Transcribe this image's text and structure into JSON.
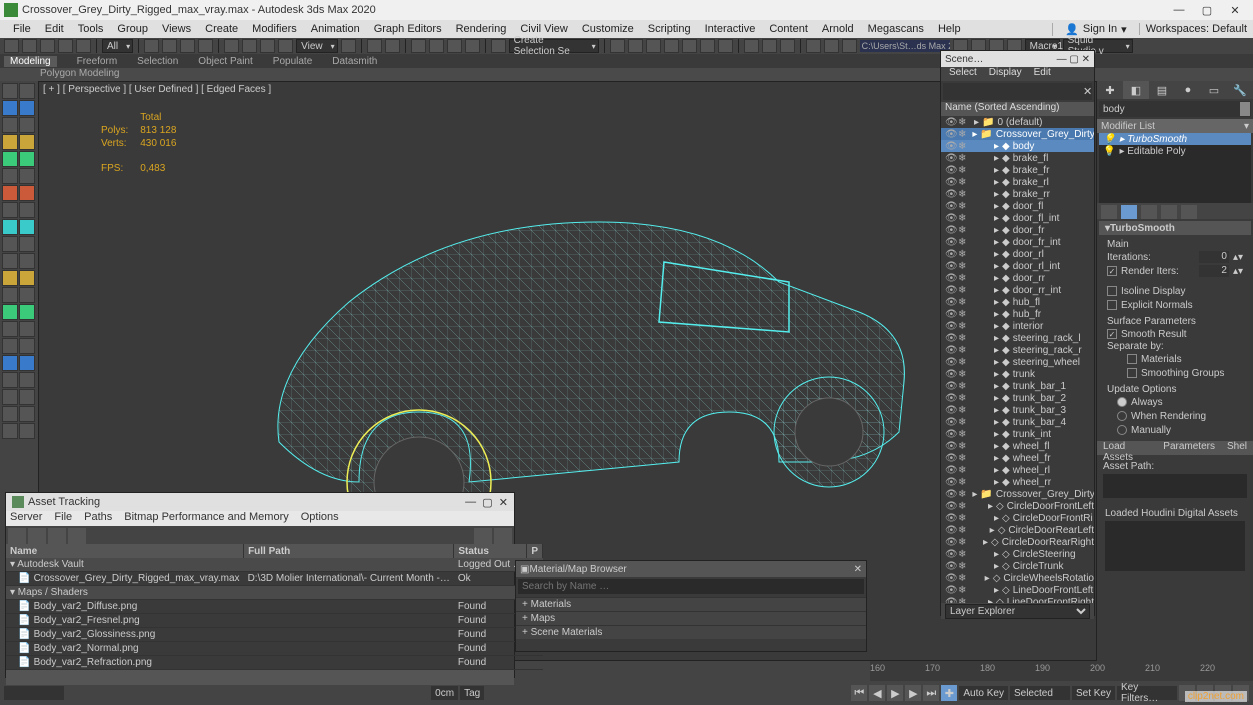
{
  "window": {
    "title": "Crossover_Grey_Dirty_Rigged_max_vray.max - Autodesk 3ds Max 2020"
  },
  "menubar": {
    "items": [
      "File",
      "Edit",
      "Tools",
      "Group",
      "Views",
      "Create",
      "Modifiers",
      "Animation",
      "Graph Editors",
      "Rendering",
      "Civil View",
      "Customize",
      "Scripting",
      "Interactive",
      "Content",
      "Arnold",
      "Megascans",
      "Help"
    ],
    "signin": "Sign In",
    "workspaces_label": "Workspaces:",
    "workspaces_value": "Default"
  },
  "toolbar": {
    "all": "All",
    "view": "View",
    "selset": "Create Selection Se",
    "path": "C:\\Users\\St…ds Max 202",
    "macro1": "Macro1",
    "squid": "Squid Studio v"
  },
  "ribbon": {
    "tabs": [
      "Modeling",
      "Freeform",
      "Selection",
      "Object Paint",
      "Populate",
      "Datasmith"
    ],
    "sub": "Polygon Modeling"
  },
  "viewport": {
    "label": "[ + ]  [ Perspective ]  [ User Defined ]  [ Edged Faces ]",
    "stats_total": "Total",
    "polys_label": "Polys:",
    "polys": "813 128",
    "verts_label": "Verts:",
    "verts": "430 016",
    "fps_label": "FPS:",
    "fps": "0,483"
  },
  "scene": {
    "title": "Scene…",
    "tabs": [
      "Select",
      "Display",
      "Edit"
    ],
    "search_placeholder": "",
    "header": "Name (Sorted Ascending)",
    "footer": "Layer Explorer",
    "items": [
      {
        "name": "0 (default)",
        "indent": 0,
        "sel": false,
        "icon": "layer"
      },
      {
        "name": "Crossover_Grey_Dirty_",
        "indent": 1,
        "sel": true,
        "icon": "layer"
      },
      {
        "name": "body",
        "indent": 2,
        "sel": true,
        "icon": "obj"
      },
      {
        "name": "brake_fl",
        "indent": 2,
        "icon": "obj"
      },
      {
        "name": "brake_fr",
        "indent": 2,
        "icon": "obj"
      },
      {
        "name": "brake_rl",
        "indent": 2,
        "icon": "obj"
      },
      {
        "name": "brake_rr",
        "indent": 2,
        "icon": "obj"
      },
      {
        "name": "door_fl",
        "indent": 2,
        "icon": "obj"
      },
      {
        "name": "door_fl_int",
        "indent": 2,
        "icon": "obj"
      },
      {
        "name": "door_fr",
        "indent": 2,
        "icon": "obj"
      },
      {
        "name": "door_fr_int",
        "indent": 2,
        "icon": "obj"
      },
      {
        "name": "door_rl",
        "indent": 2,
        "icon": "obj"
      },
      {
        "name": "door_rl_int",
        "indent": 2,
        "icon": "obj"
      },
      {
        "name": "door_rr",
        "indent": 2,
        "icon": "obj"
      },
      {
        "name": "door_rr_int",
        "indent": 2,
        "icon": "obj"
      },
      {
        "name": "hub_fl",
        "indent": 2,
        "icon": "obj"
      },
      {
        "name": "hub_fr",
        "indent": 2,
        "icon": "obj"
      },
      {
        "name": "interior",
        "indent": 2,
        "icon": "obj"
      },
      {
        "name": "steering_rack_l",
        "indent": 2,
        "icon": "obj"
      },
      {
        "name": "steering_rack_r",
        "indent": 2,
        "icon": "obj"
      },
      {
        "name": "steering_wheel",
        "indent": 2,
        "icon": "obj"
      },
      {
        "name": "trunk",
        "indent": 2,
        "icon": "obj"
      },
      {
        "name": "trunk_bar_1",
        "indent": 2,
        "icon": "obj"
      },
      {
        "name": "trunk_bar_2",
        "indent": 2,
        "icon": "obj"
      },
      {
        "name": "trunk_bar_3",
        "indent": 2,
        "icon": "obj"
      },
      {
        "name": "trunk_bar_4",
        "indent": 2,
        "icon": "obj"
      },
      {
        "name": "trunk_int",
        "indent": 2,
        "icon": "obj"
      },
      {
        "name": "wheel_fl",
        "indent": 2,
        "icon": "obj"
      },
      {
        "name": "wheel_fr",
        "indent": 2,
        "icon": "obj"
      },
      {
        "name": "wheel_rl",
        "indent": 2,
        "icon": "obj"
      },
      {
        "name": "wheel_rr",
        "indent": 2,
        "icon": "obj"
      },
      {
        "name": "Crossover_Grey_Dirty_",
        "indent": 1,
        "icon": "layer"
      },
      {
        "name": "CircleDoorFrontLeft",
        "indent": 2,
        "icon": "helper"
      },
      {
        "name": "CircleDoorFrontRi",
        "indent": 2,
        "icon": "helper"
      },
      {
        "name": "CircleDoorRearLeft",
        "indent": 2,
        "icon": "helper"
      },
      {
        "name": "CircleDoorRearRight",
        "indent": 2,
        "icon": "helper"
      },
      {
        "name": "CircleSteering",
        "indent": 2,
        "icon": "helper"
      },
      {
        "name": "CircleTrunk",
        "indent": 2,
        "icon": "helper"
      },
      {
        "name": "CircleWheelsRotatio",
        "indent": 2,
        "icon": "helper"
      },
      {
        "name": "LineDoorFrontLeft",
        "indent": 2,
        "icon": "helper"
      },
      {
        "name": "LineDoorFrontRight",
        "indent": 2,
        "icon": "helper"
      }
    ]
  },
  "cmd": {
    "objname": "body",
    "modlist": "Modifier List",
    "stack": [
      {
        "name": "TurboSmooth",
        "hl": true
      },
      {
        "name": "Editable Poly",
        "hl": false
      }
    ],
    "rollout": "TurboSmooth",
    "main": "Main",
    "iterations_label": "Iterations:",
    "iterations": "0",
    "render_iters_label": "Render Iters:",
    "render_iters": "2",
    "render_iters_chk": true,
    "isoline": "Isoline Display",
    "isoline_chk": false,
    "explicit": "Explicit Normals",
    "explicit_chk": false,
    "surfparams": "Surface Parameters",
    "smooth": "Smooth Result",
    "smooth_chk": true,
    "sepby": "Separate by:",
    "materials": "Materials",
    "materials_chk": false,
    "smgroups": "Smoothing Groups",
    "smgroups_chk": false,
    "updopt": "Update Options",
    "always": "Always",
    "whenrender": "When Rendering",
    "manually": "Manually",
    "shelf": [
      "Load Assets",
      "Parameters",
      "Shel"
    ],
    "assetpath": "Asset Path:",
    "houdini": "Loaded Houdini Digital Assets"
  },
  "assetwin": {
    "title": "Asset Tracking",
    "menus": [
      "Server",
      "File",
      "Paths",
      "Bitmap Performance and Memory",
      "Options"
    ],
    "cols": [
      "Name",
      "Full Path",
      "Status",
      "P"
    ],
    "rows": [
      {
        "cat": true,
        "name": "Autodesk Vault",
        "path": "",
        "status": "Logged Out …"
      },
      {
        "name": "Crossover_Grey_Dirty_Rigged_max_vray.max",
        "path": "D:\\3D Molier International\\- Current Month -…",
        "status": "Ok"
      },
      {
        "cat": true,
        "name": "Maps / Shaders",
        "path": "",
        "status": ""
      },
      {
        "name": "Body_var2_Diffuse.png",
        "path": "",
        "status": "Found"
      },
      {
        "name": "Body_var2_Fresnel.png",
        "path": "",
        "status": "Found"
      },
      {
        "name": "Body_var2_Glossiness.png",
        "path": "",
        "status": "Found"
      },
      {
        "name": "Body_var2_Normal.png",
        "path": "",
        "status": "Found"
      },
      {
        "name": "Body_var2_Refraction.png",
        "path": "",
        "status": "Found"
      }
    ]
  },
  "matwin": {
    "title": "Material/Map Browser",
    "search": "Search by Name …",
    "cats": [
      "Materials",
      "Maps",
      "Scene Materials"
    ]
  },
  "timeline": {
    "ticks": [
      "160",
      "170",
      "180",
      "190",
      "200",
      "210",
      "220"
    ]
  },
  "statusbar": {
    "frame": "0cm",
    "tag": "Tag",
    "autokey": "Auto Key",
    "setkey": "Set Key",
    "selected": "Selected",
    "keyfilters": "Key Filters…"
  },
  "badge": "clip2net.com"
}
